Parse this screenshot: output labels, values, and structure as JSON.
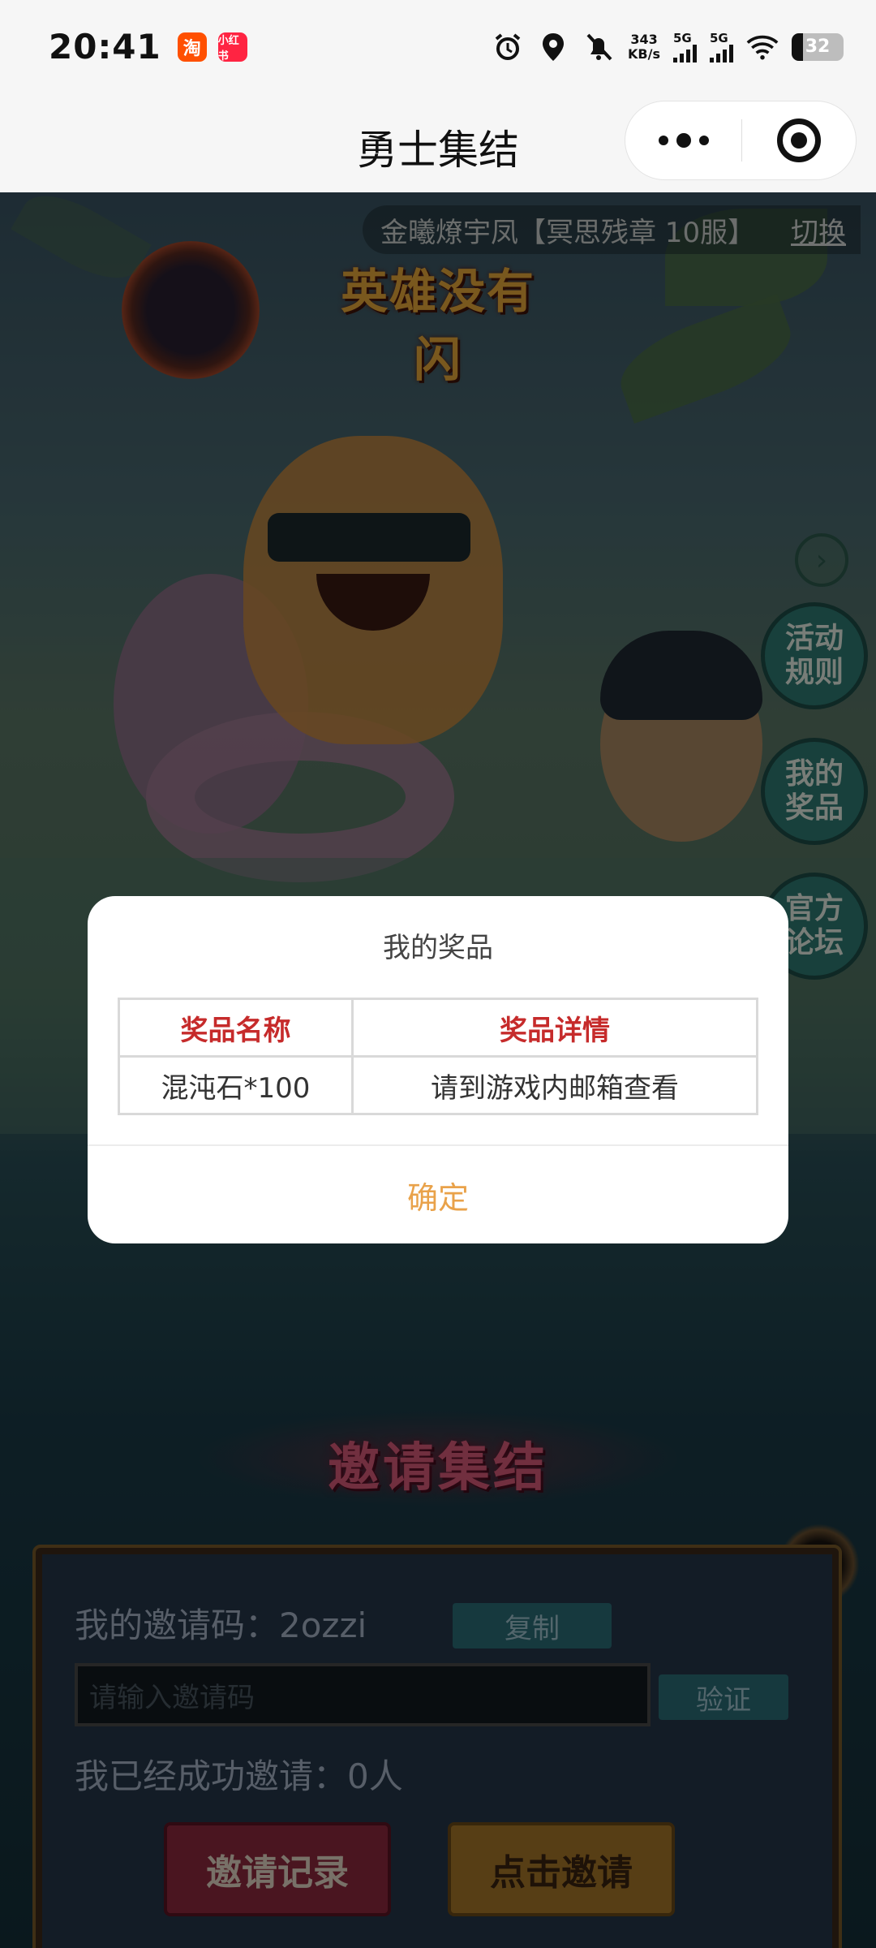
{
  "status_bar": {
    "time": "20:41",
    "apps": [
      "淘",
      "小红书"
    ],
    "net_speed_value": "343",
    "net_speed_unit": "KB/s",
    "network_1": "5G",
    "network_2": "5G",
    "battery": "32"
  },
  "title_bar": {
    "title": "勇士集结"
  },
  "game": {
    "server_name": "金曦燎宇凤【冥思残章 10服】",
    "switch_label": "切换",
    "logo_text": "英雄没有闪",
    "side_buttons": [
      "活动规则",
      "我的奖品",
      "官方论坛"
    ],
    "invite_heading": "邀请集结",
    "invite_code_label": "我的邀请码：2ozzi",
    "copy_label": "复制",
    "code_input_placeholder": "请输入邀请码",
    "verify_label": "验证",
    "invited_count_text": "我已经成功邀请：0人",
    "invite_record_label": "邀请记录",
    "click_invite_label": "点击邀请"
  },
  "modal": {
    "title": "我的奖品",
    "table": {
      "headers": [
        "奖品名称",
        "奖品详情"
      ],
      "rows": [
        [
          "混沌石*100",
          "请到游戏内邮箱查看"
        ]
      ]
    },
    "confirm_label": "确定"
  },
  "colors": {
    "accent_confirm": "#e9a24a",
    "table_header": "#c62b2b"
  }
}
